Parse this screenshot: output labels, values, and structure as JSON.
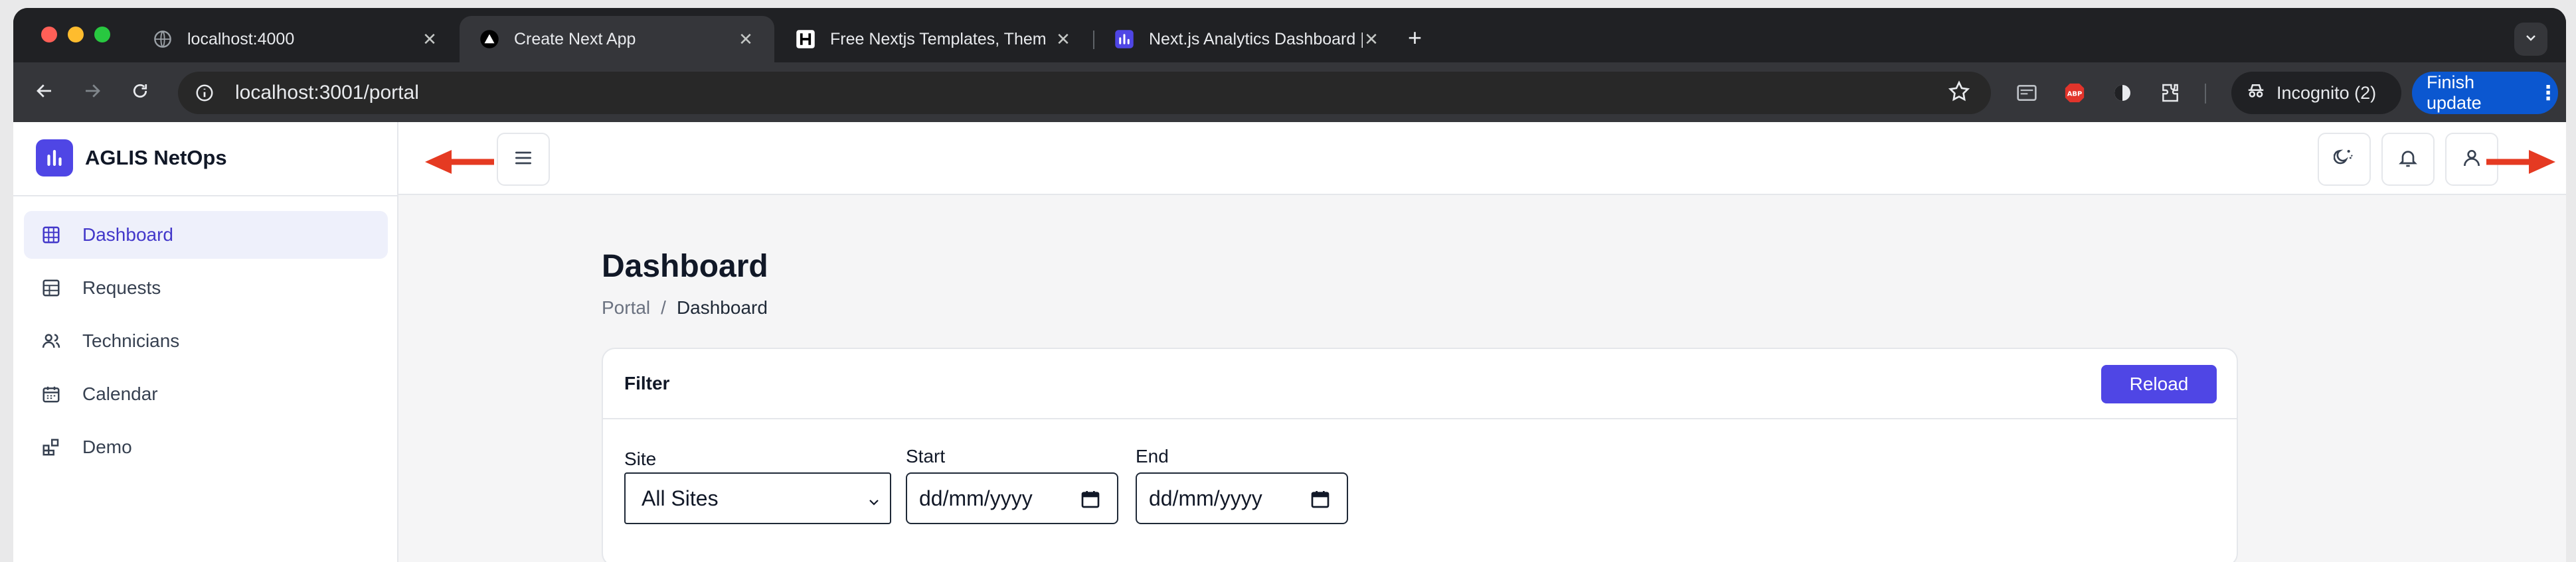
{
  "browser": {
    "tabs": [
      {
        "title": "localhost:4000",
        "favicon": "globe-icon",
        "active": false
      },
      {
        "title": "Create Next App",
        "favicon": "triangle-icon",
        "active": true
      },
      {
        "title": "Free Nextjs Templates, Them",
        "favicon": "h-logo-icon",
        "active": false
      },
      {
        "title": "Next.js Analytics Dashboard |",
        "favicon": "chart-icon",
        "active": false
      }
    ],
    "url": "localhost:3001/portal",
    "incognito_label": "Incognito (2)",
    "finish_update_label": "Finish update"
  },
  "app": {
    "brand": "AGLIS NetOps",
    "accent": "#4f46e5",
    "nav": [
      {
        "label": "Dashboard",
        "icon": "grid-icon",
        "active": true
      },
      {
        "label": "Requests",
        "icon": "table-icon",
        "active": false
      },
      {
        "label": "Technicians",
        "icon": "users-icon",
        "active": false
      },
      {
        "label": "Calendar",
        "icon": "calendar-icon",
        "active": false
      },
      {
        "label": "Demo",
        "icon": "widgets-icon",
        "active": false
      }
    ],
    "topbar_icons": [
      "theme-toggle-icon",
      "bell-icon",
      "user-icon"
    ]
  },
  "page": {
    "title": "Dashboard",
    "breadcrumb": [
      "Portal",
      "/",
      "Dashboard"
    ]
  },
  "filter": {
    "title": "Filter",
    "reload_label": "Reload",
    "site_label": "Site",
    "site_value": "All Sites",
    "start_label": "Start",
    "start_placeholder": "dd/mm/yyyy",
    "end_label": "End",
    "end_placeholder": "dd/mm/yyyy"
  }
}
